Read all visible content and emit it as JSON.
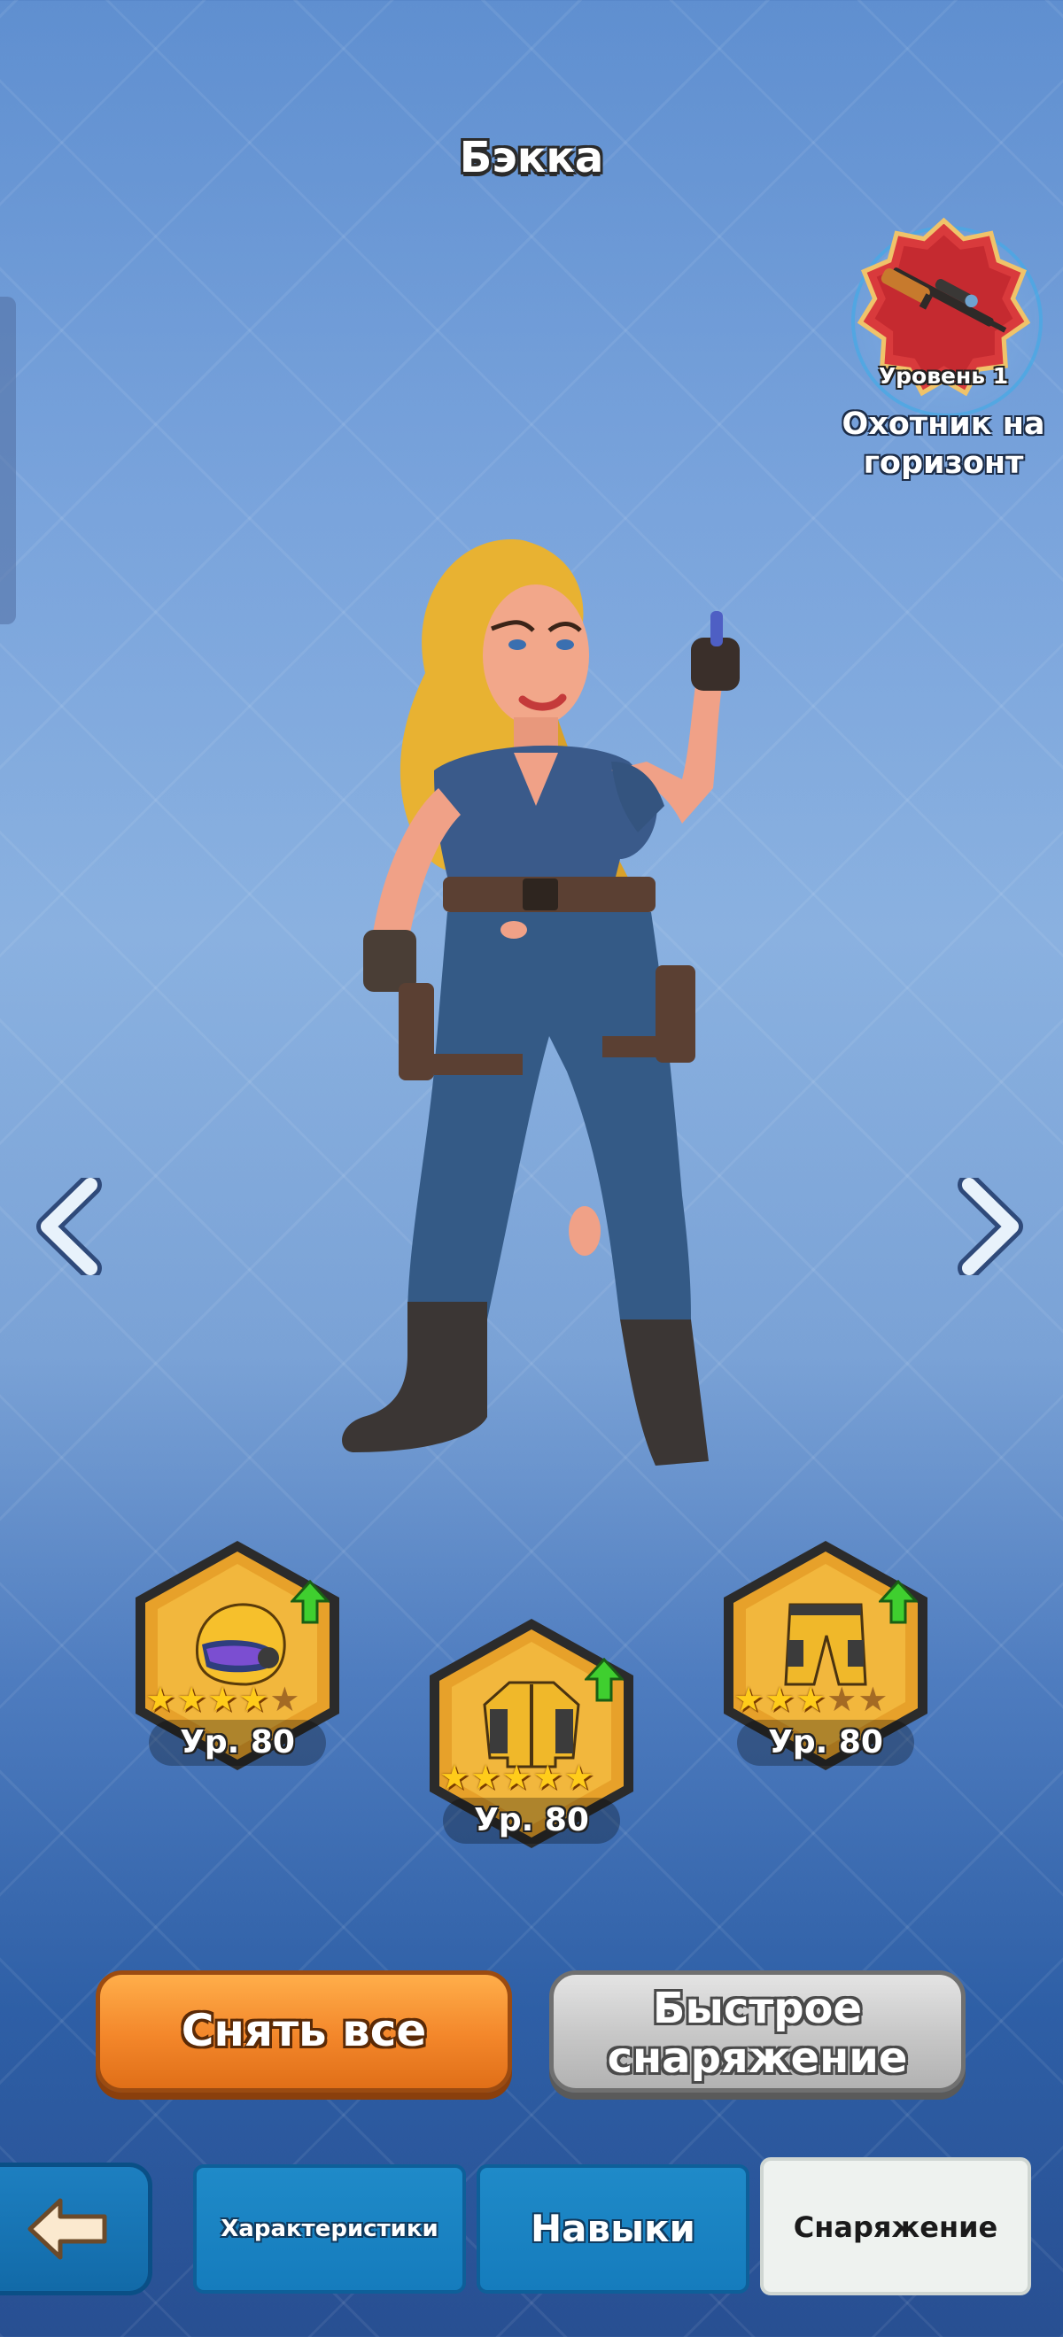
{
  "hero": {
    "name": "Бэкка"
  },
  "weapon": {
    "level_label": "Уровень 1",
    "name_line1": "Охотник на",
    "name_line2": "горизонт",
    "icon": "sniper-rifle-icon"
  },
  "navigation": {
    "prev_icon": "chevron-left-icon",
    "next_icon": "chevron-right-icon"
  },
  "gear": {
    "helmet": {
      "icon": "helmet-icon",
      "stars": 4,
      "max_stars": 5,
      "level": "Ур. 80",
      "upgrade_available": true
    },
    "jacket": {
      "icon": "jacket-icon",
      "stars": 5,
      "max_stars": 5,
      "level": "Ур. 80",
      "upgrade_available": true
    },
    "pants": {
      "icon": "pants-icon",
      "stars": 3,
      "max_stars": 5,
      "level": "Ур. 80",
      "upgrade_available": true
    }
  },
  "actions": {
    "unequip_all": "Снять все",
    "quick_equip_line1": "Быстрое",
    "quick_equip_line2": "снаряжение"
  },
  "tabs": {
    "back_icon": "back-arrow-icon",
    "stats": "Характеристики",
    "skills": "Навыки",
    "equipment": "Снаряжение",
    "active": "equipment"
  },
  "colors": {
    "orange_button": "#f3862a",
    "grey_button": "#c6c6c6",
    "tab_blue": "#157cbd",
    "tab_active": "#eef2ef",
    "star": "#ffcc1a",
    "upgrade_arrow": "#3fcf2f",
    "gear_frame": "#e7a12a"
  }
}
